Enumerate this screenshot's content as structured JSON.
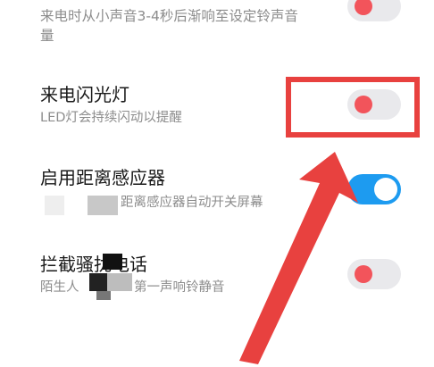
{
  "prev_setting": {
    "description_line1": "来电时从小声音3-4秒后渐响至设定铃声音",
    "description_line2": "量",
    "toggle": {
      "state": "off",
      "knob_color": "#f2545b"
    }
  },
  "flash_setting": {
    "title": "来电闪光灯",
    "description": "LED灯会持续闪动以提醒",
    "toggle": {
      "state": "off",
      "knob_color": "#f2545b"
    }
  },
  "proximity_setting": {
    "title": "启用距离感应器",
    "description": "距离感应器自动开关屏幕",
    "toggle": {
      "state": "on",
      "track_color": "#1d9bf0"
    }
  },
  "block_setting": {
    "title": "拦截骚扰电话",
    "description_left": "陌生人",
    "description_right": "第一声响铃静音",
    "toggle": {
      "state": "off",
      "knob_color": "#f2545b"
    }
  },
  "annotation": {
    "color": "#e8413f",
    "arrow_icon": "red-arrow",
    "box": "highlight-box"
  }
}
